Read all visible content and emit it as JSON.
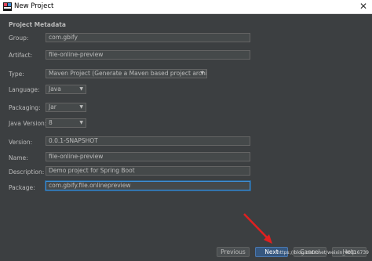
{
  "window": {
    "title": "New Project",
    "close_glyph": "✕"
  },
  "section_title": "Project Metadata",
  "fields": {
    "group": {
      "label": "Group:",
      "value": "com.gbify"
    },
    "artifact": {
      "label": "Artifact:",
      "value": "file-online-preview"
    },
    "type": {
      "label": "Type:",
      "value": "Maven Project (Generate a Maven based project archive.)"
    },
    "language": {
      "label": "Language:",
      "value": "Java"
    },
    "packaging": {
      "label": "Packaging:",
      "value": "Jar"
    },
    "java_version": {
      "label": "Java Version:",
      "value": "8"
    },
    "version": {
      "label": "Version:",
      "value": "0.0.1-SNAPSHOT"
    },
    "name": {
      "label": "Name:",
      "value": "file-online-preview"
    },
    "description": {
      "label": "Description:",
      "value": "Demo project for Spring Boot"
    },
    "package": {
      "label": "Package:",
      "value": "com.gbify.file.onlinepreview"
    }
  },
  "buttons": {
    "previous": "Previous",
    "next": "Next",
    "cancel": "Cancel",
    "help": "Help"
  },
  "watermark": "https://blog.csdn.net/weixin_40516739",
  "colors": {
    "background": "#3c3f41",
    "accent": "#365880",
    "arrow": "#e02020"
  }
}
